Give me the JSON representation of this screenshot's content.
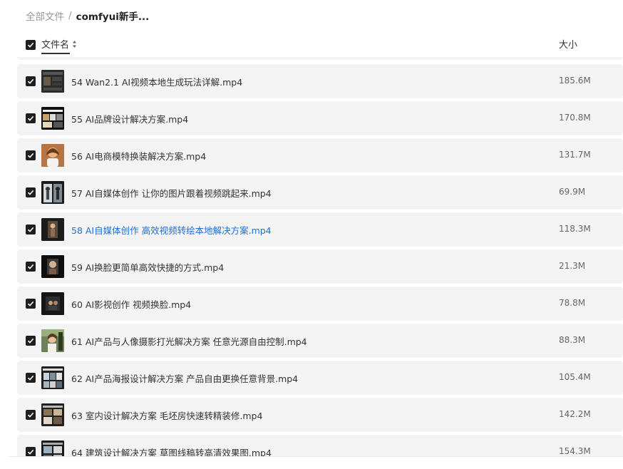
{
  "breadcrumb": {
    "root": "全部文件",
    "separator": "/",
    "current": "comfyui新手..."
  },
  "header": {
    "name_label": "文件名",
    "size_label": "大小"
  },
  "files": [
    {
      "name": "54 Wan2.1 AI视频本地生成玩法详解.mp4",
      "size": "185.6M",
      "thumb": "dark-ui"
    },
    {
      "name": "55 AI品牌设计解决方案.mp4",
      "size": "170.8M",
      "thumb": "brand"
    },
    {
      "name": "56 AI电商模特换装解决方案.mp4",
      "size": "131.7M",
      "thumb": "portrait"
    },
    {
      "name": "57 AI自媒体创作 让你的图片跟着视频跳起来.mp4",
      "size": "69.9M",
      "thumb": "dance"
    },
    {
      "name": "58 AI自媒体创作 高效视频转绘本地解决方案.mp4",
      "size": "118.3M",
      "thumb": "figure",
      "highlight": true
    },
    {
      "name": "59 AI换脸更简单高效快捷的方式.mp4",
      "size": "21.3M",
      "thumb": "face"
    },
    {
      "name": "60 AI影视创作 视频换脸.mp4",
      "size": "78.8M",
      "thumb": "film"
    },
    {
      "name": "61 AI产品与人像摄影打光解决方案 任意光源自由控制.mp4",
      "size": "88.3M",
      "thumb": "light"
    },
    {
      "name": "62 AI产品海报设计解决方案 产品自由更换任意背景.mp4",
      "size": "105.4M",
      "thumb": "poster"
    },
    {
      "name": "63 室内设计解决方案 毛坯房快速转精装修.mp4",
      "size": "142.2M",
      "thumb": "interior"
    },
    {
      "name": "64 建筑设计解决方案 草图线稿转高清效果图.mp4",
      "size": "154.3M",
      "thumb": "arch"
    }
  ]
}
